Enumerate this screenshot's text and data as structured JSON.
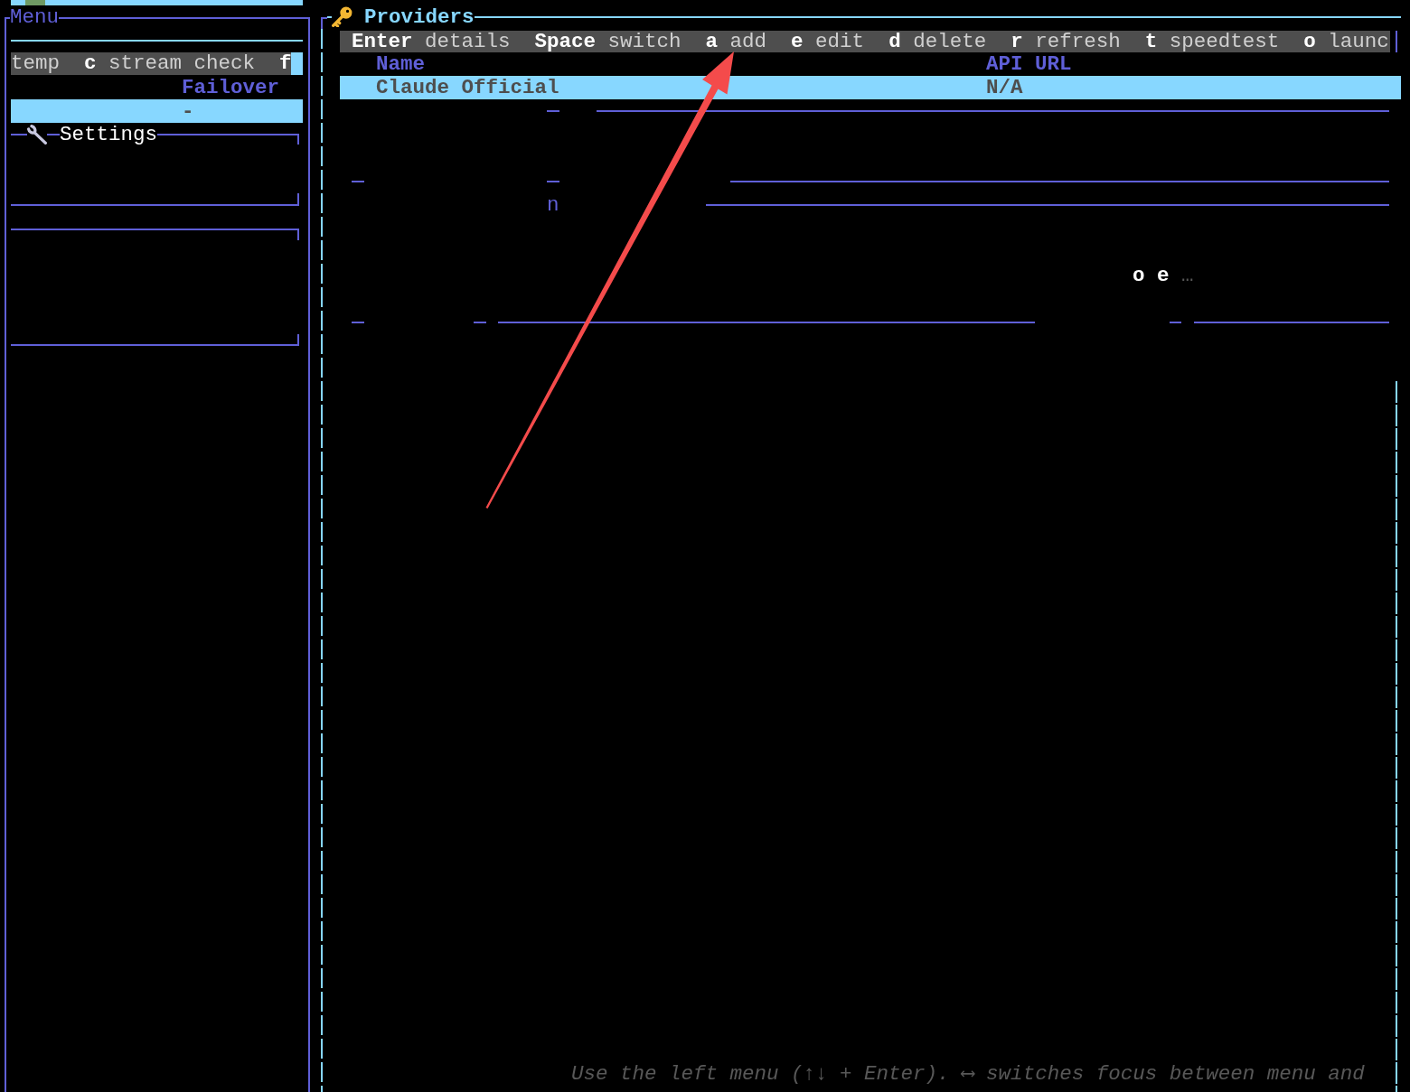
{
  "menu": {
    "title": "Menu",
    "hints": [
      {
        "desc": "temp"
      },
      {
        "key": "c",
        "desc": "stream check"
      },
      {
        "key": "f"
      }
    ],
    "items": [
      {
        "label": "Failover",
        "selected": false
      },
      {
        "label": "-",
        "selected": true
      }
    ],
    "settings": {
      "title": "Settings"
    }
  },
  "providers": {
    "title": "Providers",
    "hints": [
      {
        "key": "Enter",
        "desc": "details"
      },
      {
        "key": "Space",
        "desc": "switch"
      },
      {
        "key": "a",
        "desc": "add"
      },
      {
        "key": "e",
        "desc": "edit"
      },
      {
        "key": "d",
        "desc": "delete"
      },
      {
        "key": "r",
        "desc": "refresh"
      },
      {
        "key": "t",
        "desc": "speedtest"
      },
      {
        "key": "o",
        "desc": "launc"
      }
    ],
    "table": {
      "columns": [
        "Name",
        "API URL"
      ],
      "rows": [
        {
          "cells": [
            "Claude Official",
            "N/A"
          ],
          "selected": true
        }
      ]
    },
    "stray_marks": [
      {
        "kind": "plain",
        "text": "n"
      },
      {
        "kind": "key",
        "text": "o"
      },
      {
        "kind": "key",
        "text": "e"
      },
      {
        "kind": "dim",
        "text": "…"
      }
    ],
    "footer_hint": "Use the left menu (↑↓ + Enter). ⟷ switches focus between menu and"
  },
  "annotations": [
    {
      "kind": "arrow"
    }
  ]
}
